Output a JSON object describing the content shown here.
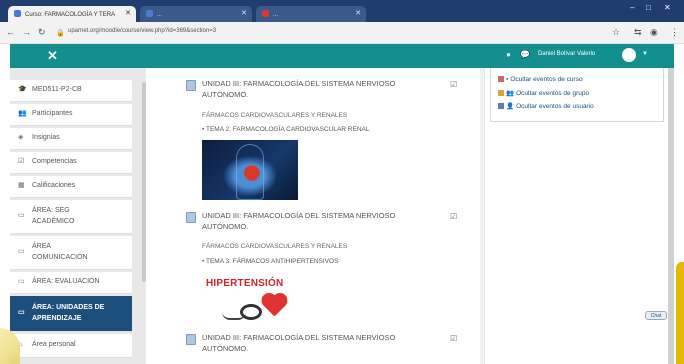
{
  "browser": {
    "tabs": [
      {
        "label": "Curso: FARMACOLOGÍA Y TERA"
      },
      {
        "label": "..."
      },
      {
        "label": "..."
      }
    ],
    "url": "uparnet.org/moodle/course/view.php?id=369&section=3"
  },
  "topnav": {
    "user_name": "Daniel Bolívar Valerio"
  },
  "sidebar": {
    "items": [
      {
        "label": "MED511-P2-CB",
        "icon": "graduation-cap-icon"
      },
      {
        "label": "Participantes",
        "icon": "users-icon"
      },
      {
        "label": "Insignias",
        "icon": "badge-icon"
      },
      {
        "label": "Competencias",
        "icon": "check-icon"
      },
      {
        "label": "Calificaciones",
        "icon": "table-icon"
      },
      {
        "label": "ÁREA: SEG ACADÉMICO",
        "icon": "folder-icon"
      },
      {
        "label": "ÁREA COMUNICACIÓN",
        "icon": "folder-icon"
      },
      {
        "label": "ÁREA: EVALUACIÓN",
        "icon": "folder-icon"
      },
      {
        "label": "ÁREA: UNIDADES DE APRENDIZAJE",
        "icon": "folder-icon",
        "active": true
      },
      {
        "label": "Área personal",
        "icon": "home-icon"
      }
    ]
  },
  "main": {
    "units": [
      {
        "title": "UNIDAD III: FARMACOLOGÍA DEL SISTEMA NERVIOSO AUTÓNOMO.",
        "subheading": "FÁRMACOS CARDIOVASCULARES Y RENALES",
        "topic": "TEMA 2: FARMACOLOGÍA CARDIOVASCULAR RENAL"
      },
      {
        "title": "UNIDAD III: FARMACOLOGÍA DEL SISTEMA NERVIOSO AUTÓNOMO.",
        "subheading": "FÁRMACOS CARDIOVASCULARES Y RENALES",
        "topic": "TEMA 3: FÁRMACOS ANTIHIPERTENSIVOS",
        "image_text": "HIPERTENSIÓN"
      },
      {
        "title": "UNIDAD III: FARMACOLOGÍA DEL SISTEMA NERVIOSO AUTÓNOMO."
      }
    ]
  },
  "events": {
    "items": [
      {
        "label": "Ocultar eventos de curso"
      },
      {
        "label": "Ocultar eventos de grupo"
      },
      {
        "label": "Ocultar eventos de usuario"
      }
    ]
  },
  "chat": {
    "label": "Chat"
  },
  "colors": {
    "navbar": "#138f8f",
    "sidebar_active": "#1d4f7c",
    "browser_tabbar": "#1f3d6e",
    "hypertension_red": "#d3222a"
  }
}
